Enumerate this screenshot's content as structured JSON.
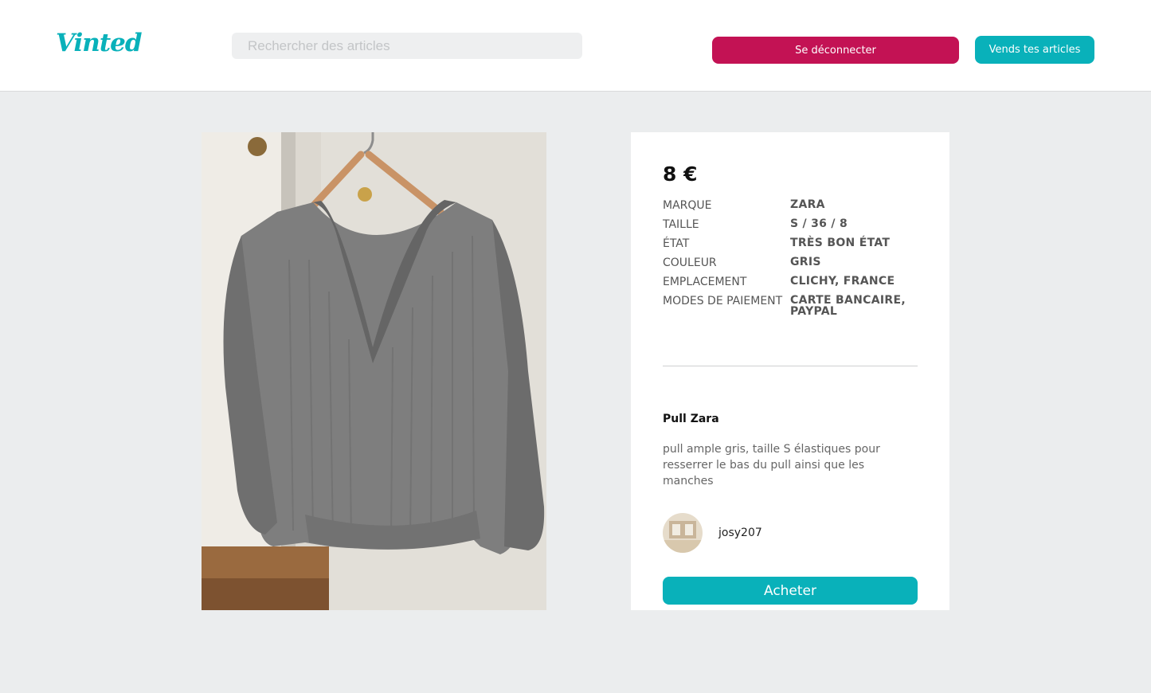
{
  "header": {
    "logo": "Vinted",
    "search_placeholder": "Rechercher des articles",
    "logout_label": "Se déconnecter",
    "sell_label": "Vends tes articles"
  },
  "product": {
    "price": "8 €",
    "details": [
      {
        "key": "MARQUE",
        "value": "ZARA"
      },
      {
        "key": "TAILLE",
        "value": "S / 36 / 8"
      },
      {
        "key": "ÉTAT",
        "value": "TRÈS BON ÉTAT"
      },
      {
        "key": "COULEUR",
        "value": "GRIS"
      },
      {
        "key": "EMPLACEMENT",
        "value": "CLICHY, FRANCE"
      },
      {
        "key": "MODES DE PAIEMENT",
        "value": "CARTE BANCAIRE, PAYPAL"
      }
    ],
    "title": "Pull Zara",
    "description": "pull ample gris, taille S élastiques pour resserrer le bas du pull ainsi que les manches",
    "seller": "josy207",
    "buy_label": "Acheter"
  },
  "colors": {
    "brand": "#09b1ba",
    "logout": "#c31254",
    "background": "#ebedee"
  }
}
